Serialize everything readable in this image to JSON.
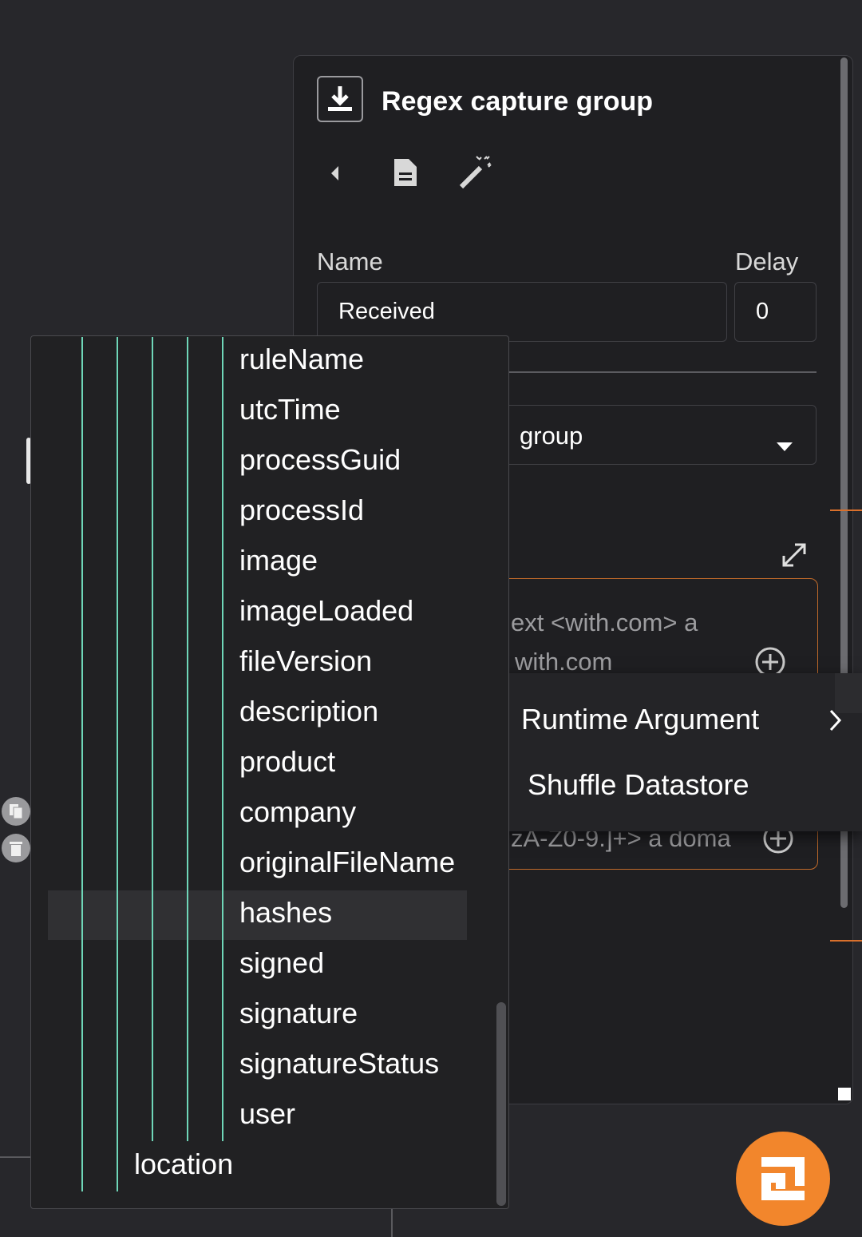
{
  "panel": {
    "title": "Regex capture group",
    "icon": "download-icon",
    "toolbar": [
      "collapse-left-icon",
      "document-icon",
      "magic-wand-icon"
    ],
    "name_label": "Name",
    "name_value": "Received",
    "delay_label": "Delay",
    "delay_value": "0",
    "action_partial": "group",
    "param_line1": "ext <with.com> a",
    "param_line2": "with.com",
    "param_line3": "zA-Z0-9.]+> a doma"
  },
  "context_menu": {
    "items": [
      {
        "label": "Runtime Argument",
        "has_submenu": true
      },
      {
        "label": "Shuffle Datastore",
        "has_submenu": false
      }
    ]
  },
  "dropdown": {
    "items": [
      "ruleName",
      "utcTime",
      "processGuid",
      "processId",
      "image",
      "imageLoaded",
      "fileVersion",
      "description",
      "product",
      "company",
      "originalFileName",
      "hashes",
      "signed",
      "signature",
      "signatureStatus",
      "user"
    ],
    "last_item": "location",
    "highlighted": "hashes"
  },
  "colors": {
    "accent": "#f2862c",
    "tree_line": "#6fd6b8",
    "background": "#27272b"
  }
}
